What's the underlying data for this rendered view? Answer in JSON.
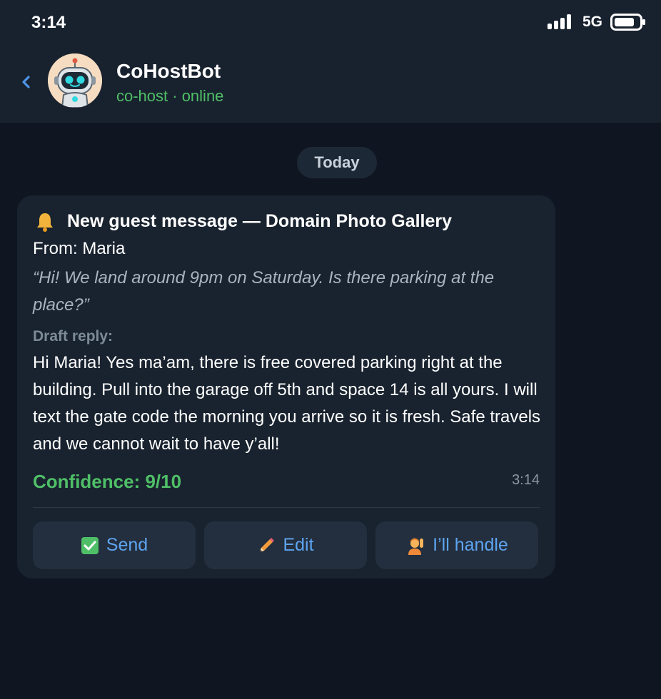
{
  "status_bar": {
    "time": "3:14",
    "network": "5G"
  },
  "header": {
    "bot_name": "CoHostBot",
    "subtitle": "co-host · online",
    "avatar_icon": "robot-avatar-icon"
  },
  "chat": {
    "date_label": "Today"
  },
  "message": {
    "heading": "New guest message — Domain Photo Gallery",
    "from": "From: Maria",
    "guest_quote": "“Hi! We land around 9pm on Saturday. Is there parking at the place?”",
    "draft_label": "Draft reply:",
    "draft_text": "Hi Maria! Yes ma’am, there is free covered parking right at the building. Pull into the garage off 5th and space 14 is all yours. I will text the gate code the morning you arrive so it is fresh. Safe travels and we cannot wait to have y’all!",
    "confidence": "Confidence: 9/10",
    "time": "3:14"
  },
  "actions": {
    "send_label": "Send",
    "edit_label": "Edit",
    "handle_label": "I’ll handle"
  },
  "colors": {
    "accent_green": "#4fbf67",
    "link_blue": "#5ea4f0",
    "background": "#0f1621",
    "header_bg": "#18222e",
    "bubble_bg": "#19232f"
  }
}
